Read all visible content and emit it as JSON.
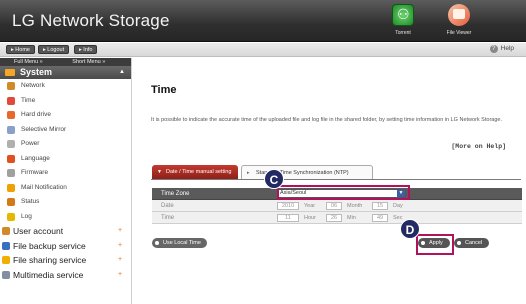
{
  "header": {
    "title": "LG Network Storage",
    "icons": [
      {
        "label": "Torrent",
        "icon": "torrent-icon"
      },
      {
        "label": "File Viewer",
        "icon": "file-viewer-icon"
      }
    ]
  },
  "toolbar": {
    "home": "Home",
    "logout": "Logout",
    "info": "Info",
    "help": "Help"
  },
  "sidebar": {
    "full_menu": "Full Menu »",
    "short_menu": "Short Menu »",
    "section": "System",
    "sub_items": [
      {
        "label": "Network",
        "icon": "network-icon",
        "color": "#d08a2a"
      },
      {
        "label": "Time",
        "icon": "clock-icon",
        "color": "#e04a3a"
      },
      {
        "label": "Hard drive",
        "icon": "hard-drive-icon",
        "color": "#e8672c"
      },
      {
        "label": "Selective Mirror",
        "icon": "mirror-icon",
        "color": "#8aa0c8"
      },
      {
        "label": "Power",
        "icon": "power-icon",
        "color": "#b0b0b0"
      },
      {
        "label": "Language",
        "icon": "language-icon",
        "color": "#e05020"
      },
      {
        "label": "Firmware",
        "icon": "firmware-icon",
        "color": "#a0a0a0"
      },
      {
        "label": "Mail Notification",
        "icon": "mail-icon",
        "color": "#f0a000"
      },
      {
        "label": "Status",
        "icon": "status-icon",
        "color": "#d07a1a"
      },
      {
        "label": "Log",
        "icon": "log-icon",
        "color": "#e6b800"
      }
    ],
    "main_items": [
      {
        "label": "User account",
        "icon": "user-account-icon",
        "color": "#d08a2a"
      },
      {
        "label": "File backup service",
        "icon": "file-backup-icon",
        "color": "#3a70c0"
      },
      {
        "label": "File sharing service",
        "icon": "file-sharing-icon",
        "color": "#f0b000"
      },
      {
        "label": "Multimedia service",
        "icon": "multimedia-icon",
        "color": "#8090a0"
      }
    ]
  },
  "main": {
    "title": "Time",
    "description": "It is possible to indicate the accurate time of the uploaded file and log file in the shared folder, by setting time information in LG Network Storage.",
    "more_help": "[More on Help]",
    "tabs": [
      {
        "label": "Date / Time manual setting"
      },
      {
        "label": "Standard Time Synchronization (NTP)"
      }
    ],
    "form": {
      "time_zone_label": "Time Zone",
      "time_zone_value": "Asia/Seoul",
      "date_label": "Date",
      "date_year": "2010",
      "date_year_unit": "Year",
      "date_month": "06",
      "date_month_unit": "Month",
      "date_day": "15",
      "date_day_unit": "Day",
      "time_label": "Time",
      "time_hour": "11",
      "time_hour_unit": "Hour",
      "time_min": "26",
      "time_min_unit": "Min",
      "time_sec": "49",
      "time_sec_unit": "Sec"
    },
    "buttons": {
      "use_local_time": "Use Local Time",
      "apply": "Apply",
      "cancel": "Cancel"
    }
  },
  "callouts": {
    "c": "C",
    "d": "D"
  },
  "colors": {
    "accent": "#b0125e",
    "tab_active": "#a8281f",
    "callout": "#232a63"
  }
}
